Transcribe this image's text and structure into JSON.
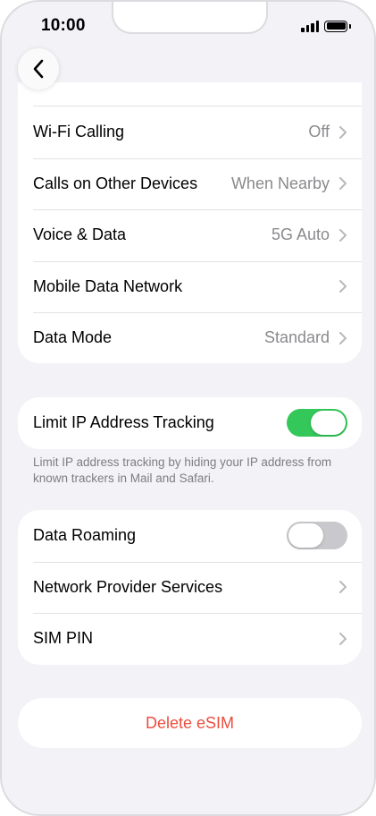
{
  "status_bar": {
    "time": "10:00"
  },
  "cellular_rows": [
    {
      "label": "Wi-Fi Calling",
      "value": "Off"
    },
    {
      "label": "Calls on Other Devices",
      "value": "When Nearby"
    },
    {
      "label": "Voice & Data",
      "value": "5G Auto"
    },
    {
      "label": "Mobile Data Network",
      "value": ""
    },
    {
      "label": "Data Mode",
      "value": "Standard"
    }
  ],
  "limit_ip": {
    "label": "Limit IP Address Tracking",
    "enabled": true,
    "footnote": "Limit IP address tracking by hiding your IP address from known trackers in Mail and Safari."
  },
  "roaming_rows": [
    {
      "label": "Data Roaming",
      "toggle": false
    },
    {
      "label": "Network Provider Services"
    },
    {
      "label": "SIM PIN"
    }
  ],
  "delete_esim_label": "Delete eSIM",
  "colors": {
    "toggle_on": "#34c759",
    "destructive": "#eb4d3d",
    "secondary_text": "#8a8a8e"
  },
  "icons": {
    "back": "chevron-left-icon",
    "disclosure": "chevron-right-icon"
  }
}
